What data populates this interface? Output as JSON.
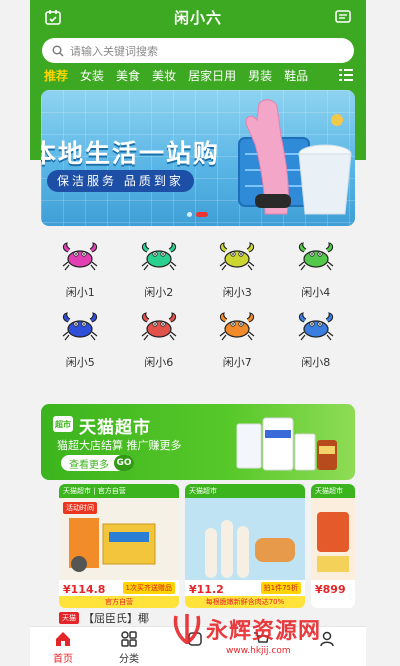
{
  "header": {
    "title": "闲小六"
  },
  "search": {
    "placeholder": "请输入关键词搜索"
  },
  "categories": [
    "推荐",
    "女装",
    "美食",
    "美妆",
    "居家日用",
    "男装",
    "鞋品"
  ],
  "banner": {
    "headline": "本地生活一站购",
    "tag": "保洁服务 品质到家"
  },
  "grid": [
    {
      "label": "闲小1",
      "color": "#e23fb3"
    },
    {
      "label": "闲小2",
      "color": "#2bd08f"
    },
    {
      "label": "闲小3",
      "color": "#cbd630"
    },
    {
      "label": "闲小4",
      "color": "#52c94a"
    },
    {
      "label": "闲小5",
      "color": "#2f4fd8"
    },
    {
      "label": "闲小6",
      "color": "#e0524a"
    },
    {
      "label": "闲小7",
      "color": "#f08a2a"
    },
    {
      "label": "闲小8",
      "color": "#3a7ee0"
    }
  ],
  "tmall": {
    "badge": "超市",
    "title": "天猫超市",
    "subtitle": "猫超大店结算 推广赚更多",
    "more": "查看更多",
    "go": "GO"
  },
  "products": [
    {
      "top": "天猫超市 | 官方自营",
      "promo": "活动时间",
      "price": "¥114.8",
      "tag": "1次买齐送赠品",
      "foot": "官方自营"
    },
    {
      "top": "天猫超市",
      "promo": "",
      "price": "¥11.2",
      "tag": "拍1件75折",
      "foot": "每根脆嫩新鲜含肉达70%"
    },
    {
      "top": "天猫超市",
      "promo": "",
      "price": "¥899",
      "tag": "",
      "foot": ""
    }
  ],
  "peek": {
    "badge": "天猫",
    "text": "【屈臣氏】椰"
  },
  "tabs": [
    {
      "label": "首页",
      "icon": "home-icon"
    },
    {
      "label": "分类",
      "icon": "category-icon"
    },
    {
      "label": "",
      "icon": "brand-icon"
    },
    {
      "label": "",
      "icon": "cart-icon"
    },
    {
      "label": "",
      "icon": "profile-icon"
    }
  ],
  "watermark": {
    "text": "永辉资源网",
    "url": "www.hkjij.com"
  },
  "colors": {
    "primary": "#3da822",
    "accent": "#e4262a",
    "highlight": "#ffd400"
  }
}
